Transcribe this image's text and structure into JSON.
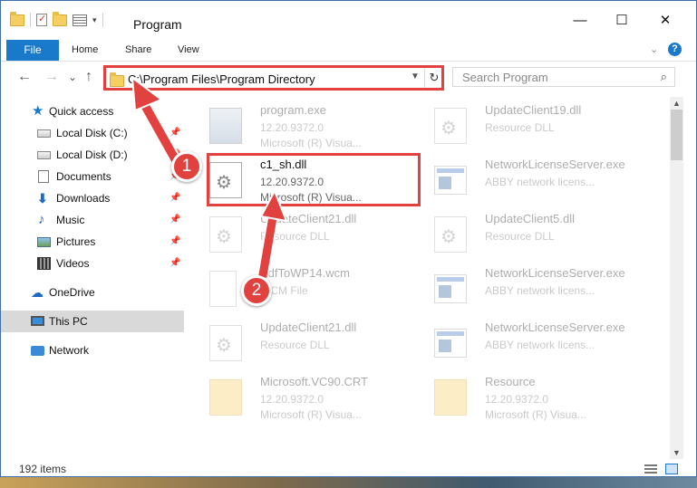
{
  "window": {
    "title": "Program",
    "minimize": "—",
    "maximize": "☐",
    "close": "✕"
  },
  "ribbon": {
    "tabs": [
      "File",
      "Home",
      "Share",
      "View"
    ]
  },
  "nav": {
    "back": "←",
    "forward": "→",
    "recent": "⌄",
    "up": "↑",
    "address": "C:\\Program Files\\Program Directory",
    "search_placeholder": "Search Program"
  },
  "sidebar": {
    "items": [
      {
        "label": "Quick access",
        "icon": "star-icon"
      },
      {
        "label": "Local Disk (C:)",
        "icon": "disk-icon"
      },
      {
        "label": "Local Disk (D:)",
        "icon": "disk-icon"
      },
      {
        "label": "Documents",
        "icon": "document-icon"
      },
      {
        "label": "Downloads",
        "icon": "download-icon"
      },
      {
        "label": "Music",
        "icon": "music-icon"
      },
      {
        "label": "Pictures",
        "icon": "pictures-icon"
      },
      {
        "label": "Videos",
        "icon": "videos-icon"
      },
      {
        "label": "OneDrive",
        "icon": "cloud-icon"
      },
      {
        "label": "This PC",
        "icon": "computer-icon"
      },
      {
        "label": "Network",
        "icon": "network-icon"
      }
    ]
  },
  "files": [
    {
      "name": "program.exe",
      "line2": "12.20.9372.0",
      "line3": "Microsoft (R) Visua...",
      "icon": "program-icon"
    },
    {
      "name": "UpdateClient19.dll",
      "line2": "Resource DLL",
      "line3": "",
      "icon": "dll-icon"
    },
    {
      "name": "c1_sh.dll",
      "line2": "12.20.9372.0",
      "line3": "Microsoft (R) Visua...",
      "icon": "dll-icon"
    },
    {
      "name": "NetworkLicenseServer.exe",
      "line2": "ABBY network licens...",
      "line3": "",
      "icon": "exe-icon"
    },
    {
      "name": "UpdateClient21.dll",
      "line2": "Resource DLL",
      "line3": "",
      "icon": "dll-icon"
    },
    {
      "name": "UpdateClient5.dll",
      "line2": "Resource DLL",
      "line3": "",
      "icon": "dll-icon"
    },
    {
      "name": "PdfToWP14.wcm",
      "line2": "WCM File",
      "line3": "",
      "icon": "file-icon"
    },
    {
      "name": "NetworkLicenseServer.exe",
      "line2": "ABBY network licens...",
      "line3": "",
      "icon": "exe-icon"
    },
    {
      "name": "UpdateClient21.dll",
      "line2": "Resource DLL",
      "line3": "",
      "icon": "dll-icon"
    },
    {
      "name": "NetworkLicenseServer.exe",
      "line2": "ABBY network licens...",
      "line3": "",
      "icon": "exe-icon"
    },
    {
      "name": "Microsoft.VC90.CRT",
      "line2": "12.20.9372.0",
      "line3": "Microsoft (R) Visua...",
      "icon": "folder-icon"
    },
    {
      "name": "Resource",
      "line2": "12.20.9372.0",
      "line3": "Microsoft (R) Visua...",
      "icon": "folder-icon"
    }
  ],
  "status": {
    "count": "192 items"
  },
  "annotations": {
    "step1": "1",
    "step2": "2",
    "color": "#e2423f"
  }
}
